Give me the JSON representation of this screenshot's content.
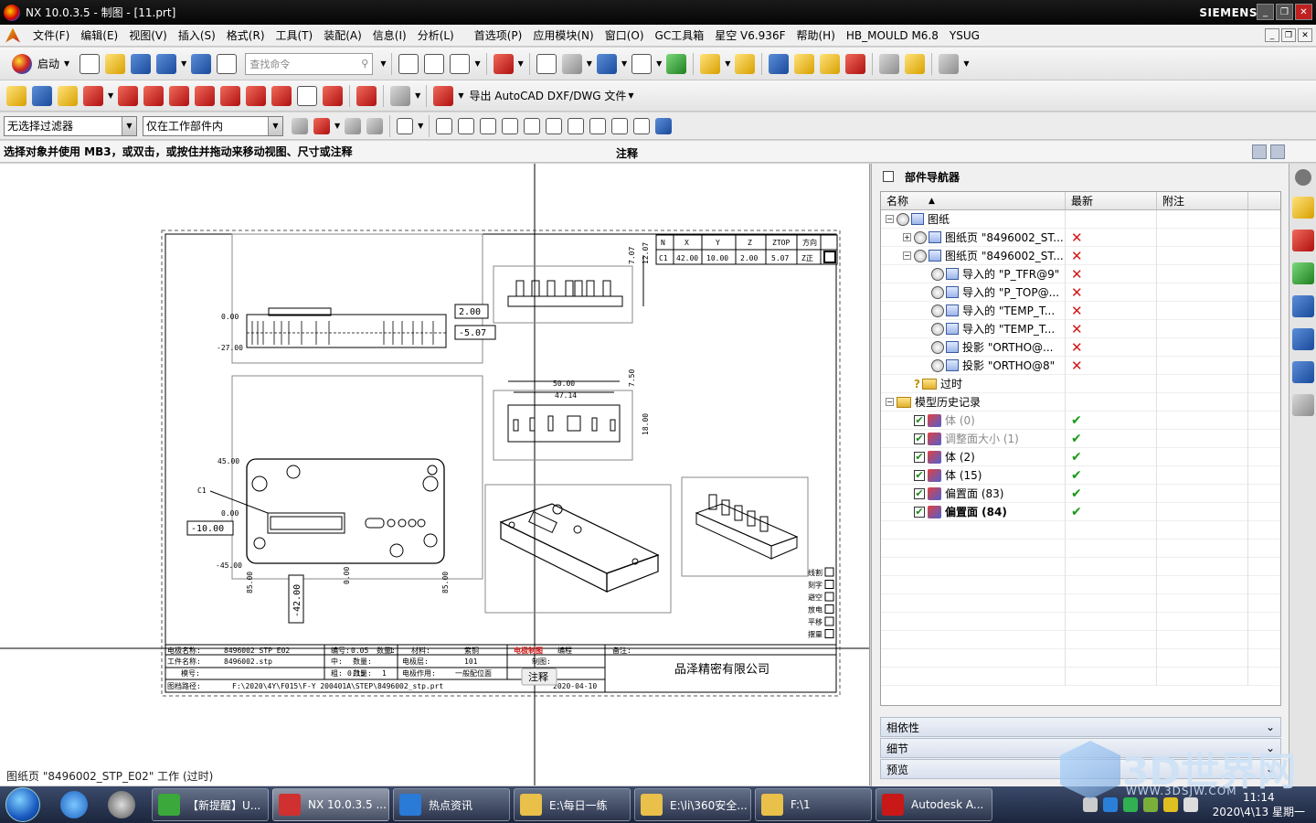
{
  "window": {
    "title": "NX 10.0.3.5 - 制图 - [11.prt]",
    "brand": "SIEMENS",
    "controls": [
      "_",
      "❐",
      "✕"
    ]
  },
  "menu": [
    "文件(F)",
    "编辑(E)",
    "视图(V)",
    "插入(S)",
    "格式(R)",
    "工具(T)",
    "装配(A)",
    "信息(I)",
    "分析(L)",
    "首选项(P)",
    "应用模块(N)",
    "窗口(O)",
    "GC工具箱",
    "星空 V6.936F",
    "帮助(H)",
    "HB_MOULD M6.8",
    "YSUG"
  ],
  "toolbar": {
    "start_label": "启动",
    "search_placeholder": "查找命令",
    "export_label": "导出 AutoCAD DXF/DWG 文件"
  },
  "filters": {
    "selection_filter": "无选择过滤器",
    "scope": "仅在工作部件内"
  },
  "cue": {
    "prompt": "选择对象并使用 MB3，或双击，或按住并拖动来移动视图、尺寸或注释",
    "status": "注释"
  },
  "drawing": {
    "status_line": "图纸页 \"8496002_STP_E02\" 工作 (过时)",
    "annotation_tooltip": "注释",
    "coord_table": {
      "headers": [
        "N",
        "X",
        "Y",
        "Z",
        "ZTOP",
        "方向"
      ],
      "row": [
        "C1",
        "42.00",
        "10.00",
        "2.00",
        "5.07",
        "Z正"
      ]
    },
    "dims": {
      "d200": "2.00",
      "d507": "-5.07",
      "d1000": "-10.00",
      "d4200": "-42.00",
      "d000": "0.00",
      "d2700": "-27.00",
      "d4500": "45.00",
      "dm4500": "-45.00",
      "d000b": "0.00",
      "d5000": "50.00",
      "d4714": "47.14",
      "d750": "7.50",
      "d1800": "18.00",
      "d707a": "7.07",
      "d707b": "12.07",
      "d85a": "85.00",
      "d85b": "85.00",
      "d4u": "0.00",
      "c1": "C1"
    },
    "checklist": [
      "线割",
      "刻字",
      "避空",
      "放电",
      "平移",
      "摆量"
    ],
    "title_block": {
      "r1": [
        "电极名称:",
        "8496002_STP_E02",
        "编号:",
        "0.05",
        "数量:",
        "1",
        "材料:",
        "紫铜"
      ],
      "r2": [
        "工件名称:",
        "8496002.stp",
        "中:",
        "",
        "数量:",
        "",
        "电极层:",
        "101"
      ],
      "r3": [
        "模号:",
        "",
        "粗:",
        "0.15",
        "数量:",
        "1",
        "电极作用:",
        "一般配位面"
      ],
      "path_label": "图档路径:",
      "path": "F:\\2020\\4Y\\F015\\F-Y 200401A\\STEP\\8496002_stp.prt",
      "tag_red": "电极制图",
      "tag2": "编程",
      "tag3": "日期:",
      "tag4": "审核",
      "note_label": "备注:",
      "date": "2020-04-10",
      "review": "制图:",
      "company": "品泽精密有限公司"
    }
  },
  "navigator": {
    "title": "部件导航器",
    "columns": [
      "名称",
      "最新",
      "附注"
    ],
    "rows": [
      {
        "indent": 0,
        "exp": "−",
        "icons": [
          "clock",
          "sheet"
        ],
        "label": "图纸",
        "status": ""
      },
      {
        "indent": 1,
        "exp": "+",
        "icons": [
          "clock",
          "sheet"
        ],
        "label": "图纸页 \"8496002_ST...",
        "status": "x"
      },
      {
        "indent": 1,
        "exp": "−",
        "icons": [
          "clock",
          "sheet"
        ],
        "label": "图纸页 \"8496002_ST...",
        "status": "x"
      },
      {
        "indent": 2,
        "exp": "",
        "icons": [
          "clock",
          "sheet"
        ],
        "label": "导入的 \"P_TFR@9\"",
        "status": "x"
      },
      {
        "indent": 2,
        "exp": "",
        "icons": [
          "clock",
          "sheet"
        ],
        "label": "导入的 \"P_TOP@...",
        "status": "x"
      },
      {
        "indent": 2,
        "exp": "",
        "icons": [
          "clock",
          "sheet"
        ],
        "label": "导入的 \"TEMP_T...",
        "status": "x"
      },
      {
        "indent": 2,
        "exp": "",
        "icons": [
          "clock",
          "sheet"
        ],
        "label": "导入的 \"TEMP_T...",
        "status": "x"
      },
      {
        "indent": 2,
        "exp": "",
        "icons": [
          "clock",
          "sheet"
        ],
        "label": "投影 \"ORTHO@...",
        "status": "x"
      },
      {
        "indent": 2,
        "exp": "",
        "icons": [
          "clock",
          "sheet"
        ],
        "label": "投影 \"ORTHO@8\"",
        "status": "x"
      },
      {
        "indent": 1,
        "exp": "",
        "icons": [
          "q",
          "folder"
        ],
        "label": "过时",
        "status": ""
      },
      {
        "indent": 0,
        "exp": "−",
        "icons": [
          "folder"
        ],
        "label": "模型历史记录",
        "status": ""
      },
      {
        "indent": 1,
        "exp": "",
        "icons": [
          "chk",
          "feat"
        ],
        "label": "体 (0)",
        "status": "ok",
        "style": "dim"
      },
      {
        "indent": 1,
        "exp": "",
        "icons": [
          "chk",
          "feat"
        ],
        "label": "调整面大小 (1)",
        "status": "ok",
        "style": "dim"
      },
      {
        "indent": 1,
        "exp": "",
        "icons": [
          "chk",
          "feat"
        ],
        "label": "体 (2)",
        "status": "ok"
      },
      {
        "indent": 1,
        "exp": "",
        "icons": [
          "chk",
          "feat"
        ],
        "label": "体 (15)",
        "status": "ok"
      },
      {
        "indent": 1,
        "exp": "",
        "icons": [
          "chk",
          "feat"
        ],
        "label": "偏置面 (83)",
        "status": "ok"
      },
      {
        "indent": 1,
        "exp": "",
        "icons": [
          "chk",
          "feat"
        ],
        "label": "偏置面 (84)",
        "status": "ok",
        "style": "bold"
      }
    ],
    "sections": [
      "相依性",
      "细节",
      "预览"
    ]
  },
  "taskbar": {
    "tasks": [
      {
        "label": "【新提醒】U...",
        "color": "#3aa83a"
      },
      {
        "label": "NX 10.0.3.5 ...",
        "color": "#d03030",
        "active": true
      },
      {
        "label": "热点资讯",
        "color": "#2a7ad8"
      },
      {
        "label": "E:\\每日一练",
        "color": "#e8c04a"
      },
      {
        "label": "E:\\li\\360安全...",
        "color": "#e8c04a"
      },
      {
        "label": "F:\\1",
        "color": "#e8c04a"
      },
      {
        "label": "Autodesk A...",
        "color": "#c81818"
      }
    ],
    "time": "11:14",
    "date": "2020\\4\\13 星期一"
  },
  "watermark": {
    "text": "3D世界网",
    "sub": "WWW.3DSJW.COM"
  }
}
